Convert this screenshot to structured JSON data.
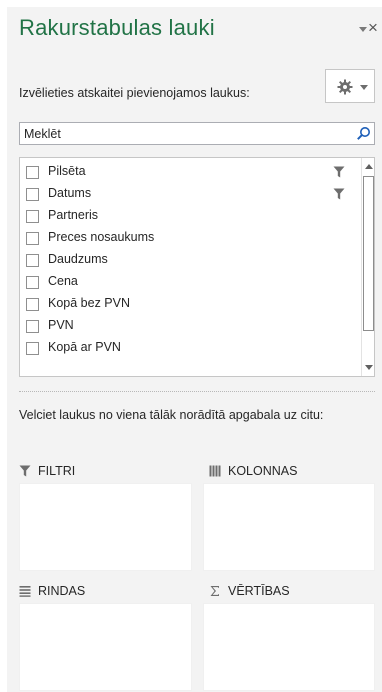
{
  "pane": {
    "title": "Rakurstabulas lauki",
    "close_symbol": "×",
    "choose_label": "Izvēlieties atskaitei pievienojamos laukus:",
    "tools_icon": "gear-icon",
    "search": {
      "placeholder": "Meklēt",
      "value": ""
    }
  },
  "fields": [
    {
      "label": "Pilsēta",
      "checked": false,
      "filtered": true
    },
    {
      "label": "Datums",
      "checked": false,
      "filtered": true
    },
    {
      "label": "Partneris",
      "checked": false,
      "filtered": false
    },
    {
      "label": "Preces nosaukums",
      "checked": false,
      "filtered": false
    },
    {
      "label": "Daudzums",
      "checked": false,
      "filtered": false
    },
    {
      "label": "Cena",
      "checked": false,
      "filtered": false
    },
    {
      "label": "Kopā bez PVN",
      "checked": false,
      "filtered": false
    },
    {
      "label": "PVN",
      "checked": false,
      "filtered": false
    },
    {
      "label": "Kopā ar PVN",
      "checked": false,
      "filtered": false
    }
  ],
  "drag_label": "Velciet laukus no viena tālāk norādītā apgabala uz citu:",
  "areas": {
    "filters": {
      "label": "FILTRI",
      "icon": "filter-icon"
    },
    "columns": {
      "label": "KOLONNAS",
      "icon": "columns-icon"
    },
    "rows": {
      "label": "RINDAS",
      "icon": "rows-icon"
    },
    "values": {
      "label": "VĒRTĪBAS",
      "icon": "sigma-icon"
    }
  },
  "colors": {
    "title": "#217346",
    "pane_bg": "#f3f3f3"
  }
}
